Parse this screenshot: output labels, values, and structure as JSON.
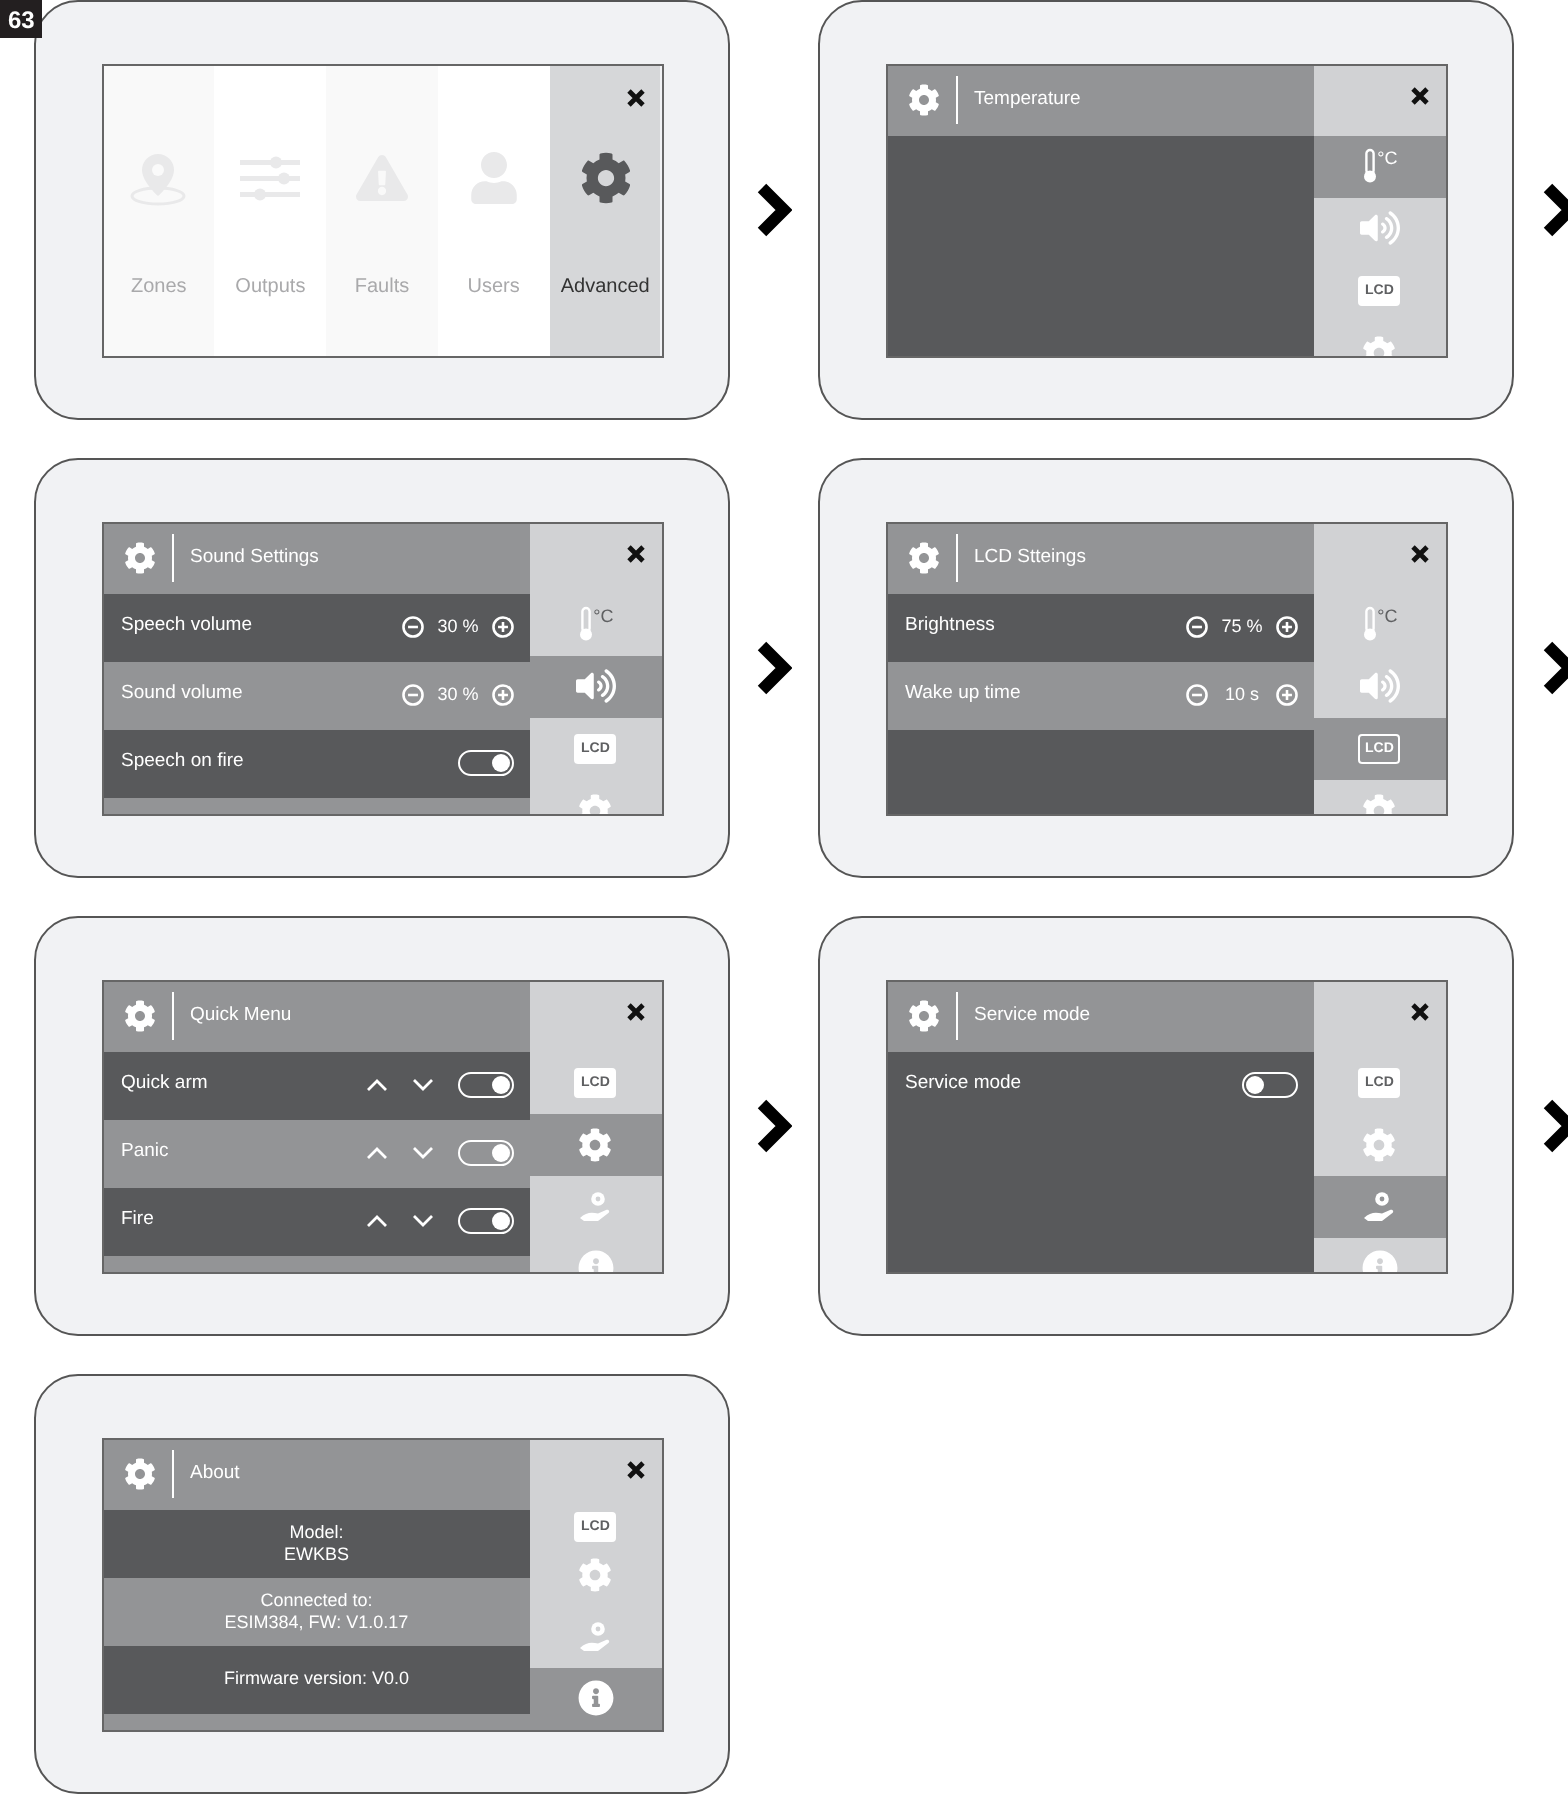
{
  "figure_label": "63",
  "panels": [
    {
      "kind": "menu",
      "tiles": [
        {
          "label": "Zones",
          "selected": false
        },
        {
          "label": "Outputs",
          "selected": false
        },
        {
          "label": "Faults",
          "selected": false
        },
        {
          "label": "Users",
          "selected": false
        },
        {
          "label": "Advanced",
          "selected": true
        }
      ]
    },
    {
      "kind": "settings",
      "title": "Temperature",
      "sidebar": [
        {
          "kind": "temperature",
          "label": "°C",
          "selected": true
        },
        {
          "kind": "sound",
          "selected": false
        },
        {
          "kind": "lcd",
          "label": "LCD",
          "selected": false
        },
        {
          "kind": "settings",
          "selected": false
        }
      ],
      "more_rows": false
    },
    {
      "kind": "settings",
      "title": "Sound Settings",
      "sidebar": [
        {
          "kind": "temperature",
          "label": "°C",
          "selected": false
        },
        {
          "kind": "sound",
          "selected": true
        },
        {
          "kind": "lcd",
          "label": "LCD",
          "selected": false
        },
        {
          "kind": "settings",
          "selected": false
        }
      ],
      "rows": [
        {
          "kind": "stepper",
          "label": "Speech volume",
          "value": "30 %"
        },
        {
          "kind": "stepper",
          "label": "Sound volume",
          "value": "30 %"
        },
        {
          "kind": "toggle",
          "label": "Speech on fire",
          "on": true
        }
      ],
      "more_rows": true
    },
    {
      "kind": "settings",
      "title": "LCD Stteings",
      "sidebar": [
        {
          "kind": "temperature",
          "label": "°C",
          "selected": false
        },
        {
          "kind": "sound",
          "selected": false
        },
        {
          "kind": "lcd",
          "label": "LCD",
          "selected": true
        },
        {
          "kind": "settings",
          "selected": false
        }
      ],
      "rows": [
        {
          "kind": "stepper",
          "label": "Brightness",
          "value": "75 %"
        },
        {
          "kind": "stepper",
          "label": "Wake up time",
          "value": "10 s"
        }
      ],
      "more_rows": false
    },
    {
      "kind": "settings",
      "title": "Quick Menu",
      "sidebar": [
        {
          "kind": "lcd",
          "label": "LCD",
          "selected": false
        },
        {
          "kind": "settings",
          "selected": true
        },
        {
          "kind": "service",
          "selected": false
        },
        {
          "kind": "info",
          "selected": false
        }
      ],
      "rows": [
        {
          "kind": "reorder",
          "label": "Quick arm",
          "on": true
        },
        {
          "kind": "reorder",
          "label": "Panic",
          "on": true
        },
        {
          "kind": "reorder",
          "label": "Fire",
          "on": true
        }
      ],
      "more_rows": true
    },
    {
      "kind": "settings",
      "title": "Service mode",
      "sidebar": [
        {
          "kind": "lcd",
          "label": "LCD",
          "selected": false
        },
        {
          "kind": "settings",
          "selected": false
        },
        {
          "kind": "service",
          "selected": true
        },
        {
          "kind": "info",
          "selected": false
        }
      ],
      "rows": [
        {
          "kind": "toggle",
          "label": "Service mode",
          "on": false
        }
      ],
      "more_rows": false
    },
    {
      "kind": "settings",
      "title": "About",
      "scrolled_to_end": true,
      "sidebar": [
        {
          "kind": "lcd",
          "label": "LCD",
          "selected": false
        },
        {
          "kind": "settings",
          "selected": false
        },
        {
          "kind": "service",
          "selected": false
        },
        {
          "kind": "info",
          "selected": true
        }
      ],
      "rows": [
        {
          "kind": "info",
          "lines": [
            "Model:",
            "EWKBS"
          ]
        },
        {
          "kind": "info",
          "lines": [
            "Connected to:",
            "ESIM384, FW: V1.0.17"
          ]
        },
        {
          "kind": "info",
          "lines": [
            "Firmware version: V0.0"
          ]
        }
      ],
      "more_rows": true
    }
  ]
}
